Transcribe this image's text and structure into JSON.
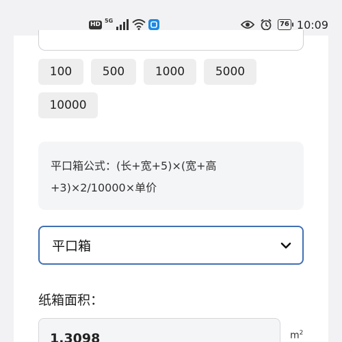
{
  "status_bar": {
    "hd": "HD",
    "network": "5G",
    "battery": "76",
    "time": "10:09",
    "icons": [
      "signal-icon",
      "wifi-icon",
      "app-notification-icon",
      "eye-icon",
      "alarm-icon",
      "battery-icon"
    ]
  },
  "quantity_chips": [
    "100",
    "500",
    "1000",
    "5000",
    "10000"
  ],
  "formula": {
    "line1": "平口箱公式：(长+宽+5)×(宽+高",
    "line2": "+3)×2/10000×单价"
  },
  "box_type_select": {
    "value": "平口箱"
  },
  "area": {
    "label": "纸箱面积：",
    "value": "1.3098",
    "unit": "m",
    "unit_sup": "2"
  },
  "colors": {
    "accent": "#3f6fb3",
    "chip_bg": "#eeeeee",
    "panel_bg": "#f4f5f7"
  }
}
